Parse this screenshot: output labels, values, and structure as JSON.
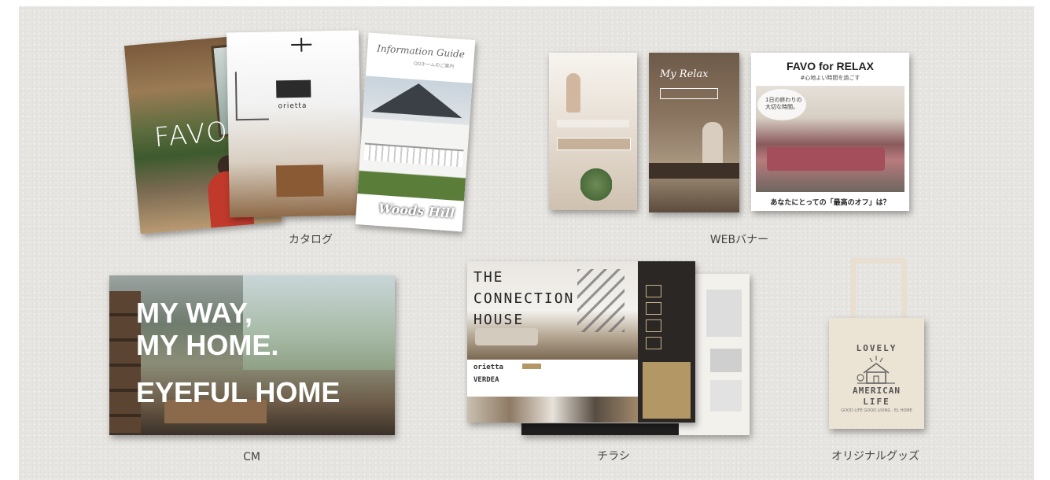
{
  "catalog": {
    "caption": "カタログ",
    "favo_title": "FAVO",
    "orietta_label": "orietta",
    "info_guide_title": "Information Guide",
    "info_guide_sub": "OOホームのご案内",
    "woods_hill": "Woods Hill"
  },
  "web_banner": {
    "caption": "WEBバナー",
    "banner3_title": "FAVO for RELAX",
    "banner3_sub": "#心地よい時間を過ごす",
    "banner3_bubble_line1": "1日の終わりの",
    "banner3_bubble_line2": "大切な時間。",
    "banner3_footer": "あなたにとっての「最高のオフ」は？",
    "banner2_script": "My Relax"
  },
  "cm": {
    "caption": "CM",
    "line1": "MY WAY,",
    "line2": "MY HOME.",
    "line3": "EYEFUL HOME"
  },
  "flyer": {
    "caption": "チラシ",
    "headline1": "THE",
    "headline2": "CONNECTION",
    "headline3": "HOUSE",
    "brand": "orietta",
    "brand2": "VERDEA"
  },
  "goods": {
    "caption": "オリジナルグッズ",
    "tote_line1": "LOVELY",
    "tote_line2": "AMERICAN",
    "tote_line3": "LIFE",
    "tote_small": "GOOD LIFE GOOD LIVING · EL HOME"
  },
  "colors": {
    "board_bg": "#e7e5e1",
    "flyer_gold": "#b39866",
    "flyer_dark": "#2a2724",
    "tote_canvas": "#ebe3d4"
  }
}
